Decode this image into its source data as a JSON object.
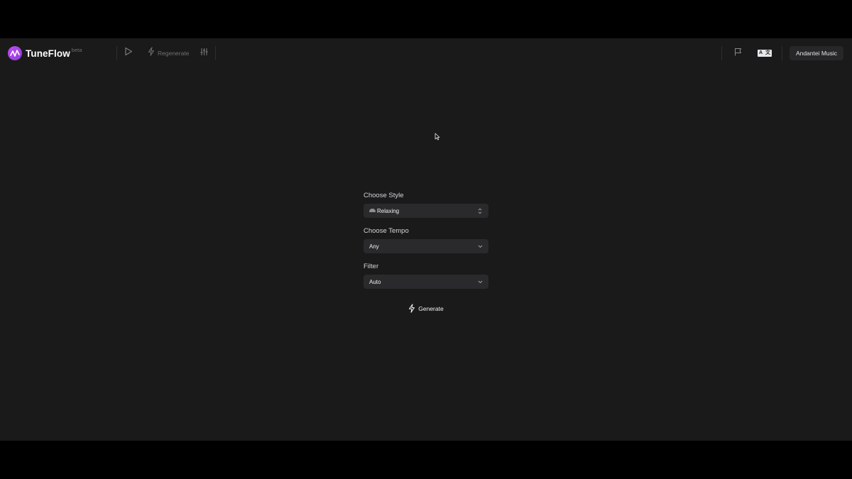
{
  "colors": {
    "background": "#1a1a1b",
    "letterbox": "#000000",
    "brand": "#b44bf0",
    "control_bg": "#2a2a2c"
  },
  "header": {
    "logo_icon": "waveform-logo-icon",
    "app_name": "TuneFlow",
    "beta_tag": "beta",
    "play_icon": "play-icon",
    "regenerate_icon": "lightning-icon",
    "regenerate_label": "Regenerate",
    "mixer_icon": "sliders-icon",
    "feedback_icon": "flag-icon",
    "language_icon": "language-translate-icon",
    "language_glyphs": [
      "A",
      "文"
    ],
    "user_label": "Andantei Music"
  },
  "form": {
    "style": {
      "label": "Choose Style",
      "icon": "rainbow-emoji-icon",
      "selected": "Relaxing",
      "control_icon": "chevron-updown-icon"
    },
    "tempo": {
      "label": "Choose Tempo",
      "selected": "Any",
      "control_icon": "chevron-down-icon"
    },
    "filter": {
      "label": "Filter",
      "selected": "Auto",
      "control_icon": "chevron-down-icon"
    },
    "generate": {
      "icon": "lightning-icon",
      "label": "Generate"
    }
  }
}
